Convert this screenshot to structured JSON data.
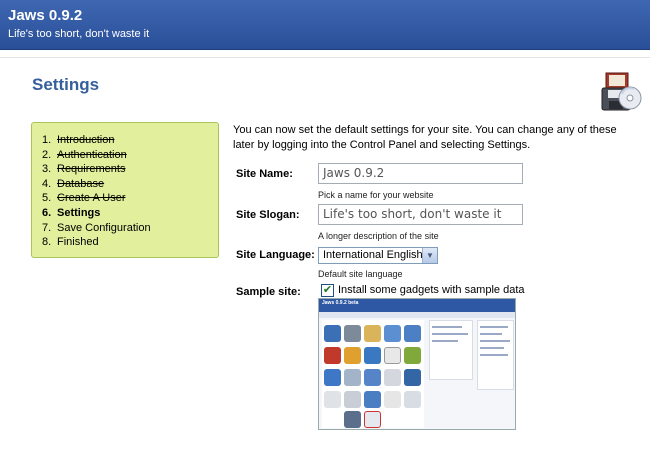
{
  "header": {
    "title": "Jaws 0.9.2",
    "tagline": "Life's too short, don't waste it"
  },
  "page": {
    "title": "Settings",
    "icon": "floppy-cd-settings-icon"
  },
  "steps": [
    {
      "num": "1.",
      "label": "Introduction",
      "state": "done"
    },
    {
      "num": "2.",
      "label": "Authentication",
      "state": "done"
    },
    {
      "num": "3.",
      "label": "Requirements",
      "state": "done"
    },
    {
      "num": "4.",
      "label": "Database",
      "state": "done"
    },
    {
      "num": "5.",
      "label": "Create A User",
      "state": "done"
    },
    {
      "num": "6.",
      "label": "Settings",
      "state": "current"
    },
    {
      "num": "7.",
      "label": "Save Configuration",
      "state": "pending"
    },
    {
      "num": "8.",
      "label": "Finished",
      "state": "pending"
    }
  ],
  "intro": "You can now set the default settings for your site. You can change any of these later by logging into the Control Panel and selecting Settings.",
  "form": {
    "site_name": {
      "label": "Site Name:",
      "value": "Jaws 0.9.2",
      "hint": "Pick a name for your website"
    },
    "site_slogan": {
      "label": "Site Slogan:",
      "value": "Life's too short, don't waste it",
      "hint": "A longer description of the site"
    },
    "site_language": {
      "label": "Site Language:",
      "value": "International English",
      "hint": "Default site language"
    },
    "sample_site": {
      "label": "Sample site:",
      "checked": true,
      "text": "Install some gadgets with sample data"
    }
  },
  "preview": {
    "title": "Jaws 0.9.2 beta"
  },
  "colors": {
    "header_bg": "#3a62ad",
    "title_blue": "#355f9b",
    "steps_bg": "#e2ef9c",
    "steps_border": "#a8c45a"
  }
}
